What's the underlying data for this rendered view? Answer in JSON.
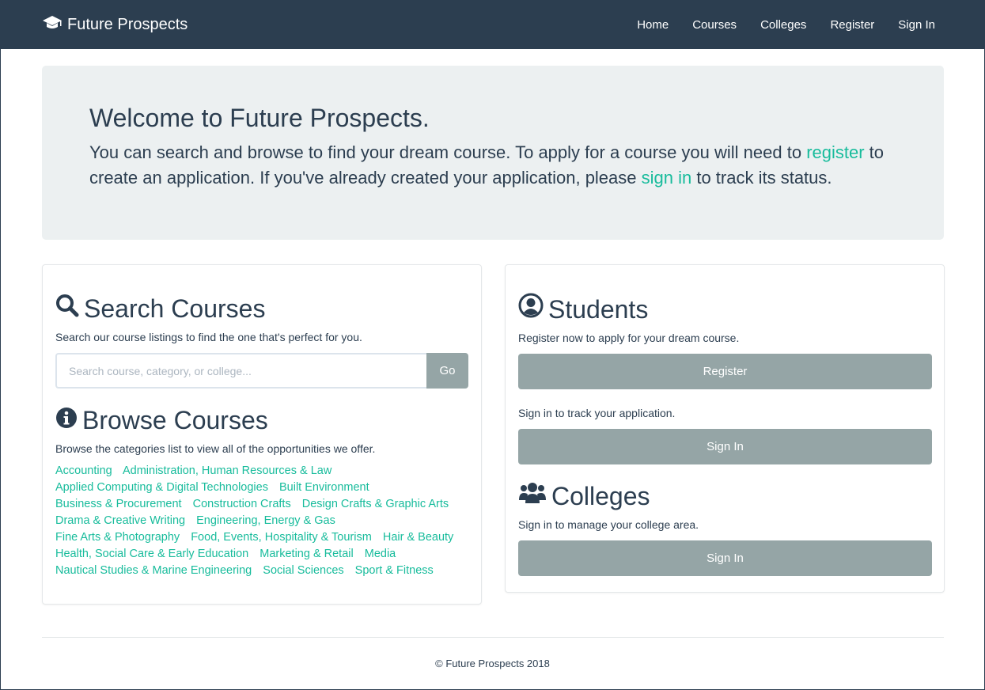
{
  "navbar": {
    "brand": "Future Prospects",
    "links": [
      "Home",
      "Courses",
      "Colleges",
      "Register",
      "Sign In"
    ]
  },
  "jumbotron": {
    "title": "Welcome to Future Prospects.",
    "text_1": "You can search and browse to find your dream course. To apply for a course you will need to ",
    "link_register": "register",
    "text_2": " to create an application. If you've already created your application, please ",
    "link_signin": "sign in",
    "text_3": " to track its status."
  },
  "search": {
    "title": "Search Courses",
    "description": "Search our course listings to find the one that's perfect for you.",
    "placeholder": "Search course, category, or college...",
    "button": "Go"
  },
  "browse": {
    "title": "Browse Courses",
    "description": "Browse the categories list to view all of the opportunities we offer.",
    "categories": [
      "Accounting",
      "Administration, Human Resources & Law",
      "Applied Computing & Digital Technologies",
      "Built Environment",
      "Business & Procurement",
      "Construction Crafts",
      "Design Crafts & Graphic Arts",
      "Drama & Creative Writing",
      "Engineering, Energy & Gas",
      "Fine Arts & Photography",
      "Food, Events, Hospitality & Tourism",
      "Hair & Beauty",
      "Health, Social Care & Early Education",
      "Marketing & Retail",
      "Media",
      "Nautical Studies & Marine Engineering",
      "Social Sciences",
      "Sport & Fitness"
    ]
  },
  "students": {
    "title": "Students",
    "register_text": "Register now to apply for your dream course.",
    "register_button": "Register",
    "signin_text": "Sign in to track your application.",
    "signin_button": "Sign In"
  },
  "colleges": {
    "title": "Colleges",
    "text": "Sign in to manage your college area.",
    "button": "Sign In"
  },
  "footer": {
    "text": "© Future Prospects 2018"
  },
  "colors": {
    "navbar": "#2c3e50",
    "accent": "#18bc9c",
    "button": "#95a5a6",
    "jumbotron": "#ecf0f1"
  }
}
